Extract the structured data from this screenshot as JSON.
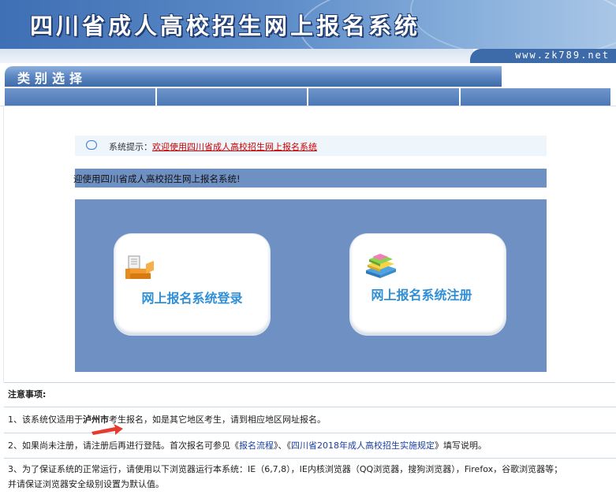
{
  "header": {
    "title": "四川省成人高校招生网上报名系统"
  },
  "site_url": "www.zk789.net",
  "category_bar": {
    "label": "类别选择"
  },
  "tabs": [
    "",
    "",
    "",
    ""
  ],
  "notice": {
    "prefix": "系统提示：",
    "message": "欢迎使用四川省成人高校招生网上报名系统",
    "icon": "speech-bubble-icon"
  },
  "welcome": "迎使用四川省成人高校招生网上报名系统!",
  "cards": {
    "login": {
      "label": "网上报名系统登录",
      "icon": "printer-icon"
    },
    "register": {
      "label": "网上报名系统注册",
      "icon": "books-icon"
    }
  },
  "notes": {
    "title": "注意事项:",
    "item1": {
      "a": "1、该系统仅适用于",
      "city": "泸州市",
      "b": "考生报名，如是其它地区考生，请到相应地区网址报名。"
    },
    "item2": {
      "a": "2、如果尚未注册，请注册后再进行登陆。首次报名可参见《",
      "link1": "报名流程",
      "b": "》、《",
      "link2": "四川省2018年成人高校招生实施规定",
      "c": "》填写说明。"
    },
    "item3": {
      "line1": "3、为了保证系统的正常运行，请使用以下浏览器运行本系统：IE（6,7,8），IE内核浏览器（QQ浏览器，搜狗浏览器），Firefox，谷歌浏览器等；",
      "line2": "并请保证浏览器安全级别设置为默认值。"
    }
  },
  "colors": {
    "accent": "#2f8fd6",
    "panel": "#6f90c2",
    "link_red": "#cc0000",
    "link_blue": "#1a3fa3"
  }
}
